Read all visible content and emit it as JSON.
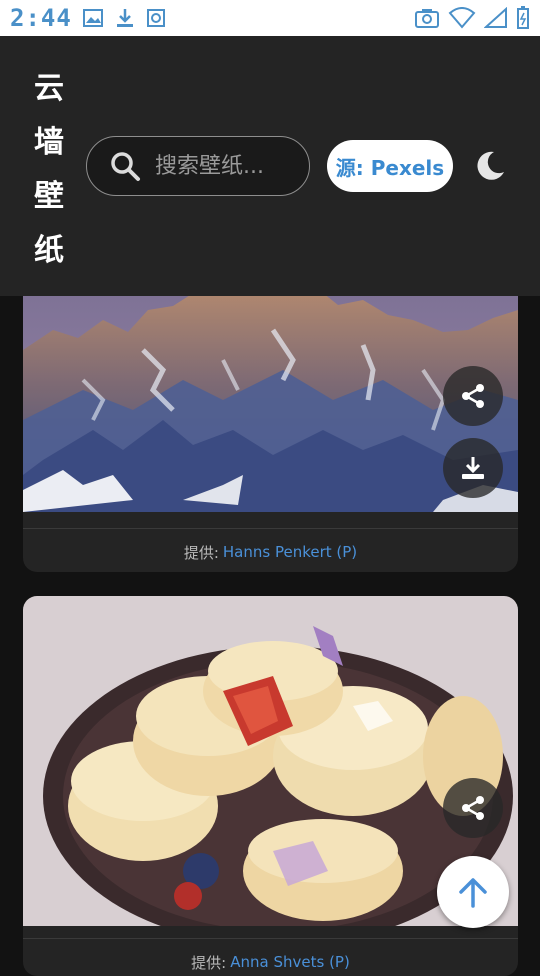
{
  "status_bar": {
    "time": "2:44"
  },
  "header": {
    "brand_chars": [
      "云",
      "墙",
      "壁",
      "纸"
    ],
    "search": {
      "placeholder": "搜索壁纸..."
    },
    "source_button_label": "源: Pexels",
    "theme_icon": "moon-icon"
  },
  "cards": [
    {
      "credit_prefix": "提供:",
      "credit_name": "Hanns Penkert (P)"
    },
    {
      "credit_prefix": "提供:",
      "credit_name": "Anna Shvets (P)"
    }
  ],
  "icons": {
    "share": "share-icon",
    "download": "download-icon",
    "to_top": "arrow-up-icon"
  },
  "colors": {
    "accent": "#4a90d8",
    "header_bg": "#242424",
    "page_bg": "#121212"
  }
}
